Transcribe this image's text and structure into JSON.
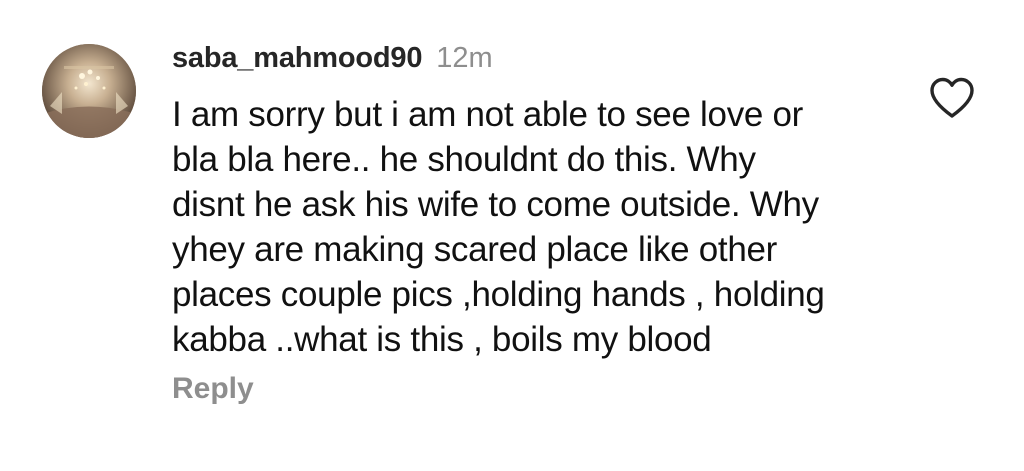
{
  "comment": {
    "username": "saba_mahmood90",
    "time_ago": "12m",
    "text_lines": [
      "I am sorry but i am not able to see love or",
      "bla bla here.. he shouldnt do this. Why",
      "disnt he ask his wife to come outside. Why",
      "yhey are making scared place like other",
      "places couple pics ,holding hands , holding",
      "kabba ..what is this , boils my blood"
    ],
    "reply_label": "Reply",
    "like_icon": "heart-outline-icon",
    "avatar_icon": "profile-photo-avatar"
  },
  "colors": {
    "username": "#262626",
    "text": "#111111",
    "muted": "#8e8e8e",
    "background": "#ffffff"
  }
}
